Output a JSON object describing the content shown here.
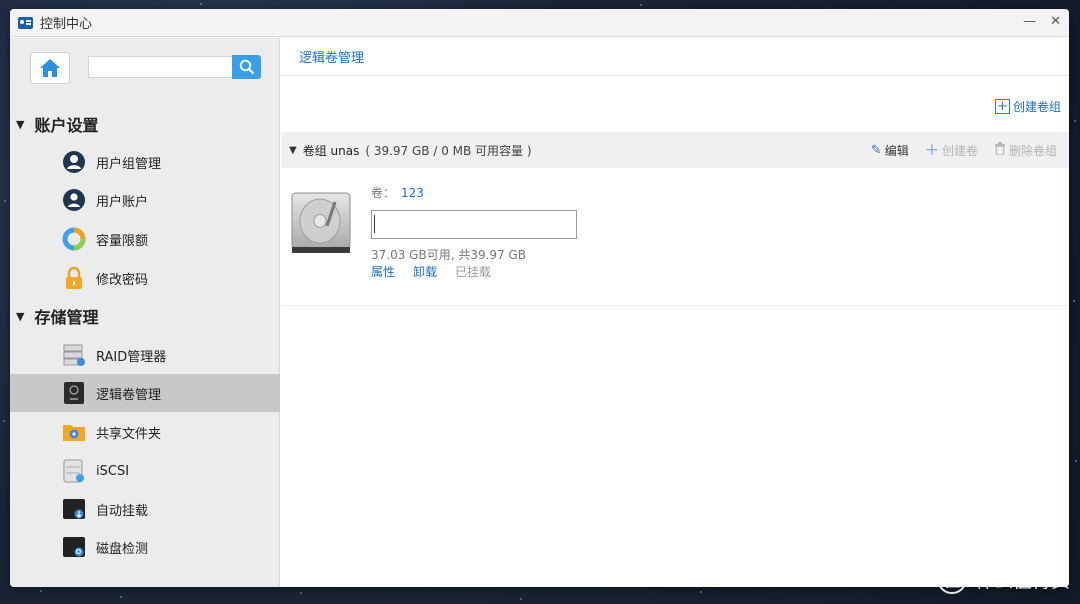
{
  "window": {
    "title": "控制中心",
    "controls": {
      "minimize": "—",
      "close": "✕"
    }
  },
  "sidebar": {
    "search": {
      "value": "",
      "placeholder": ""
    },
    "sections": [
      {
        "title": "账户设置",
        "items": [
          {
            "label": "用户组管理",
            "icon": "user-group-icon"
          },
          {
            "label": "用户账户",
            "icon": "user-account-icon"
          },
          {
            "label": "容量限额",
            "icon": "quota-icon"
          },
          {
            "label": "修改密码",
            "icon": "lock-icon"
          }
        ]
      },
      {
        "title": "存储管理",
        "items": [
          {
            "label": "RAID管理器",
            "icon": "raid-icon"
          },
          {
            "label": "逻辑卷管理",
            "icon": "lvm-icon",
            "active": true
          },
          {
            "label": "共享文件夹",
            "icon": "shared-folder-icon"
          },
          {
            "label": "iSCSI",
            "icon": "iscsi-icon"
          },
          {
            "label": "自动挂载",
            "icon": "automount-icon"
          },
          {
            "label": "磁盘检测",
            "icon": "disk-check-icon"
          }
        ]
      }
    ]
  },
  "main": {
    "breadcrumb": "逻辑卷管理",
    "create_group_label": "创建卷组",
    "group": {
      "title": "卷组 unas",
      "capacity": "( 39.97 GB / 0 MB 可用容量 )",
      "actions": {
        "edit": "编辑",
        "create_volume": "创建卷",
        "delete_group": "删除卷组"
      }
    },
    "volume": {
      "label": "卷：",
      "name": "123",
      "input_value": "",
      "usage": "37.03 GB可用, 共39.97 GB",
      "link_properties": "属性",
      "link_unmount": "卸载",
      "status": "已挂载"
    }
  },
  "watermark": {
    "logo_char": "值",
    "text": "什么值得买"
  }
}
